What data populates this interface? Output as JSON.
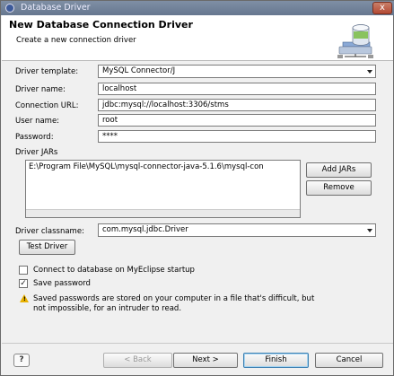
{
  "window": {
    "title": "Database Driver",
    "close_glyph": "x"
  },
  "header": {
    "title": "New Database Connection Driver",
    "subtitle": "Create a new connection driver"
  },
  "form": {
    "driver_template": {
      "label": "Driver template:",
      "value": "MySQL Connector/J"
    },
    "driver_name": {
      "label": "Driver name:",
      "value": "localhost"
    },
    "connection_url": {
      "label": "Connection URL:",
      "value": "jdbc:mysql://localhost:3306/stms"
    },
    "user_name": {
      "label": "User name:",
      "value": "root"
    },
    "password": {
      "label": "Password:",
      "value": "****"
    }
  },
  "driver_jars": {
    "label": "Driver JARs",
    "items": [
      "E:\\Program File\\MySQL\\mysql-connector-java-5.1.6\\mysql-con"
    ],
    "add_label": "Add JARs",
    "remove_label": "Remove"
  },
  "classname": {
    "label": "Driver classname:",
    "value": "com.mysql.jdbc.Driver"
  },
  "test_driver_label": "Test Driver",
  "options": {
    "connect_on_startup": {
      "label": "Connect to database on MyEclipse startup",
      "checked": false
    },
    "save_password": {
      "label": "Save password",
      "checked": true,
      "check_glyph": "✓"
    }
  },
  "warning": {
    "line1": "Saved passwords are stored on your computer in a file that's difficult, but",
    "line2": "not impossible, for an intruder to read."
  },
  "footer": {
    "help_glyph": "?",
    "back_label": "< Back",
    "next_label": "Next >",
    "finish_label": "Finish",
    "cancel_label": "Cancel"
  }
}
